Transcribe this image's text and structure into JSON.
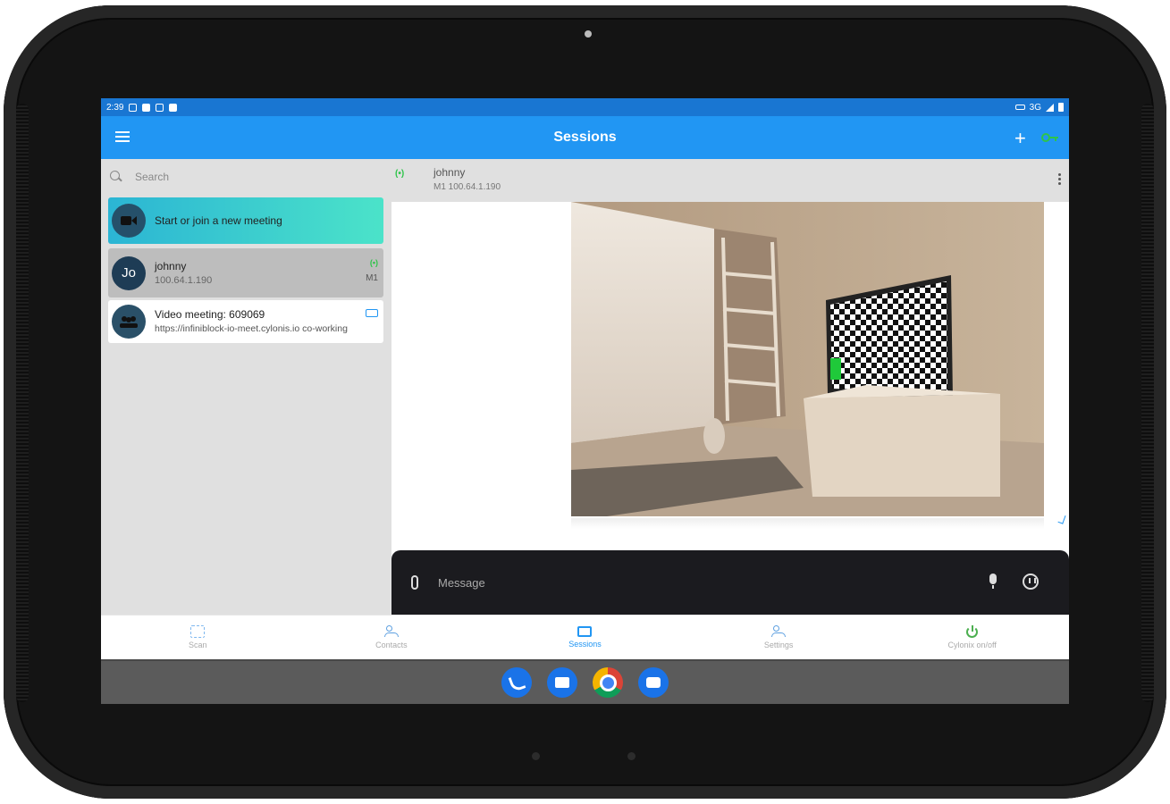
{
  "status_bar": {
    "time": "2:39",
    "network": "3G"
  },
  "app_bar": {
    "title": "Sessions"
  },
  "search": {
    "placeholder": "Search"
  },
  "sessions": [
    {
      "title": "Start or join a new meeting"
    },
    {
      "avatar": "Jo",
      "title": "johnny",
      "subtitle": "100.64.1.190",
      "tag": "M1"
    },
    {
      "title": "Video meeting: 609069",
      "subtitle": "https://infiniblock-io-meet.cylonis.io  co-working"
    }
  ],
  "chat_header": {
    "name": "johnny",
    "subtitle": "M1 100.64.1.190"
  },
  "composer": {
    "placeholder": "Message"
  },
  "bottom_nav": [
    {
      "label": "Scan"
    },
    {
      "label": "Contacts"
    },
    {
      "label": "Sessions"
    },
    {
      "label": "Settings"
    },
    {
      "label": "Cylonix on/off"
    }
  ],
  "colors": {
    "app_bar": "#2196f3",
    "status_bar": "#1976d2",
    "online": "#2ec44a",
    "composer": "#1b1b1f"
  }
}
